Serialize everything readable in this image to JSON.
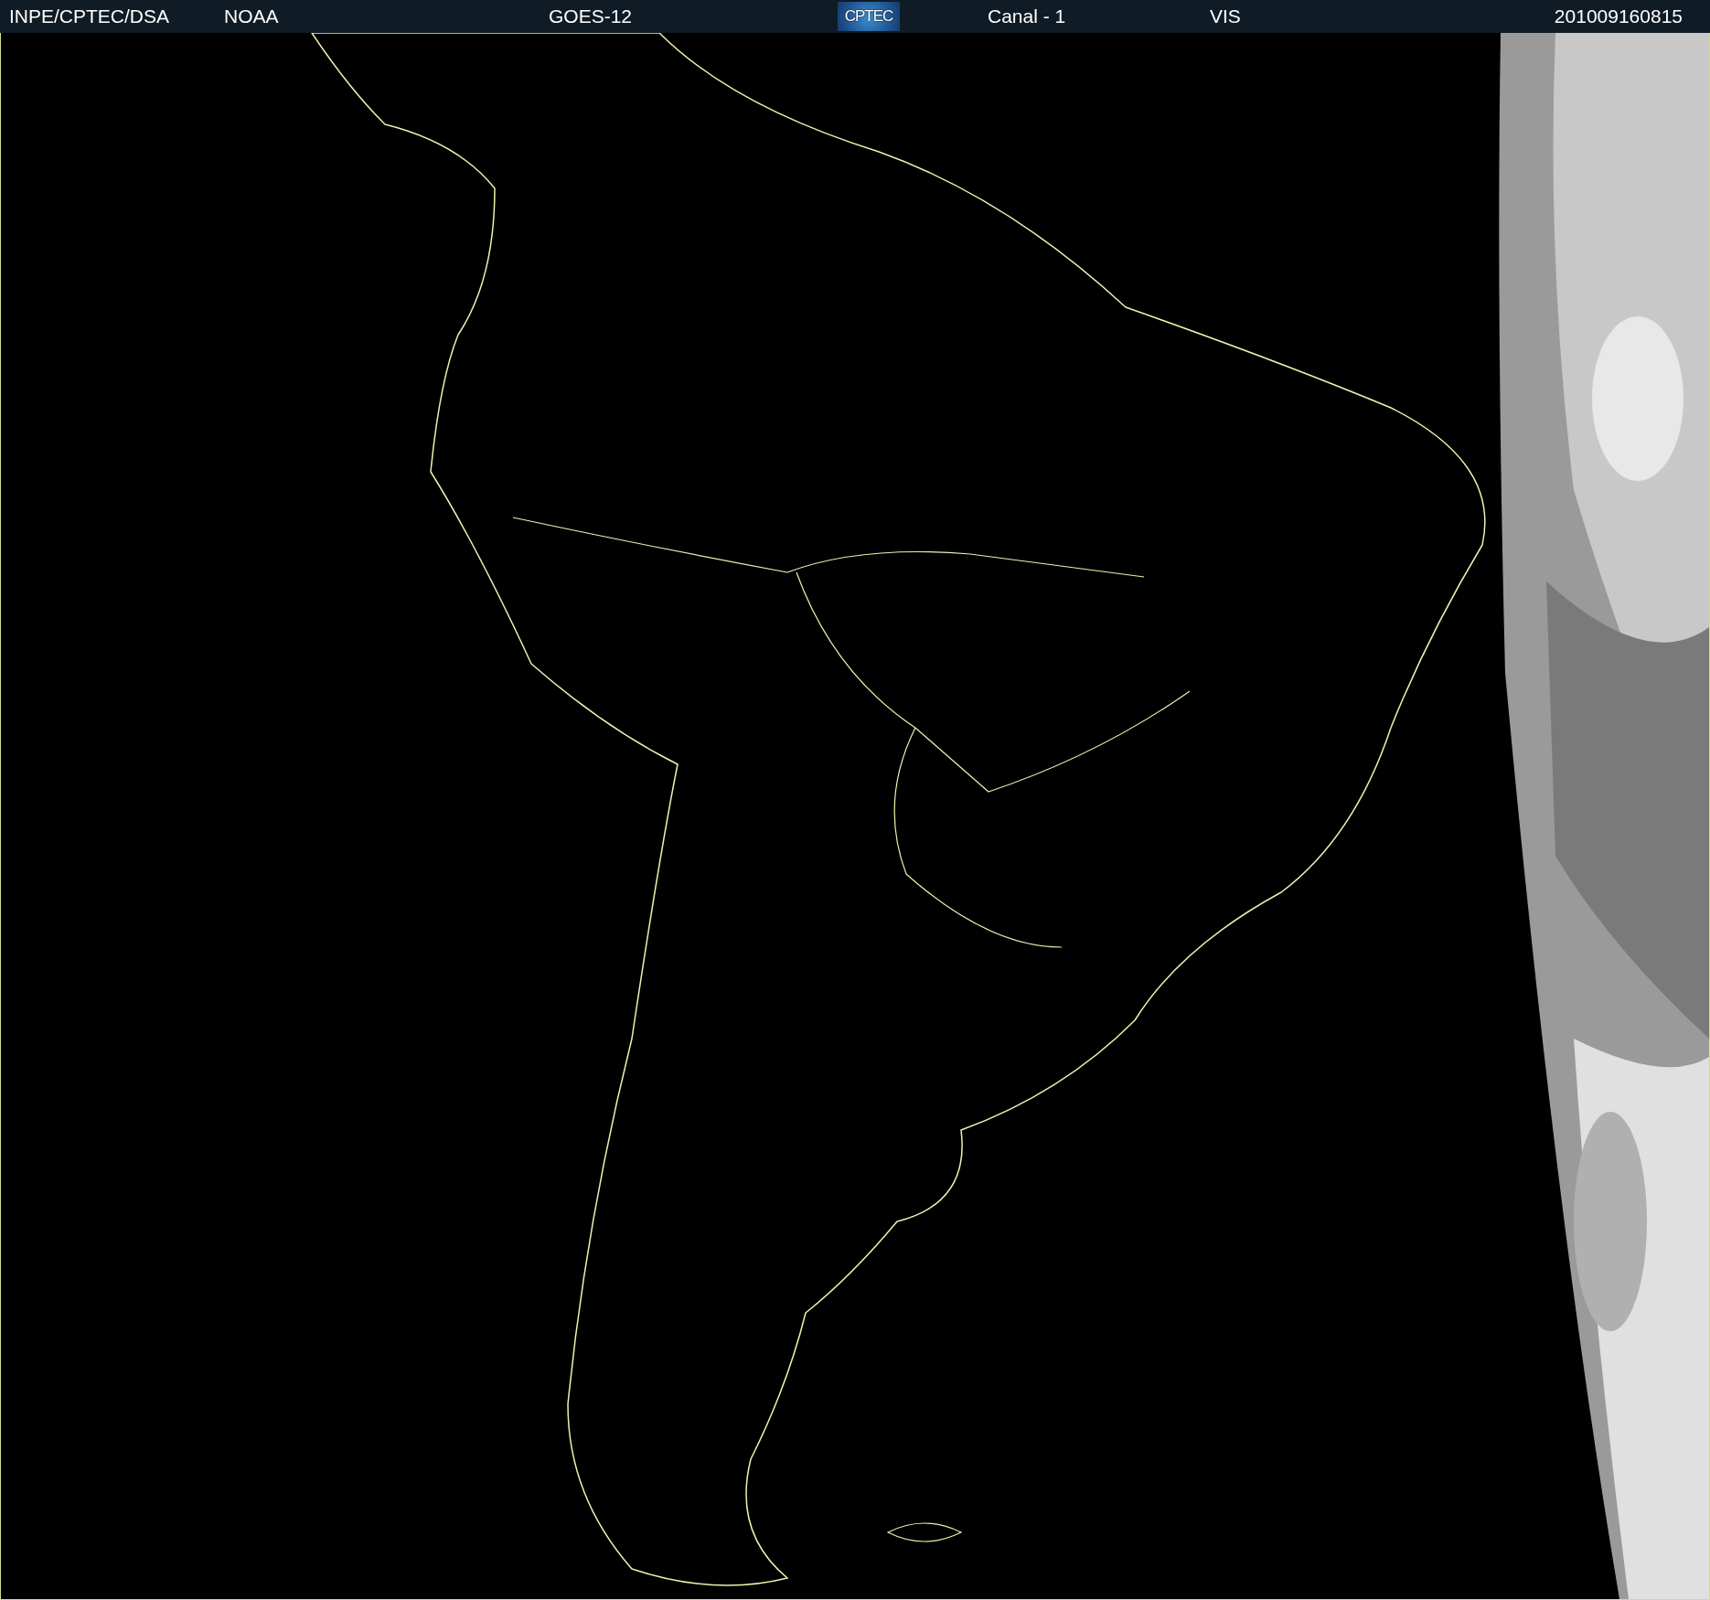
{
  "header": {
    "source": "INPE/CPTEC/DSA",
    "agency": "NOAA",
    "satellite": "GOES-12",
    "logo": "CPTEC",
    "channel": "Canal - 1",
    "band": "VIS",
    "timestamp": "201009160815"
  }
}
